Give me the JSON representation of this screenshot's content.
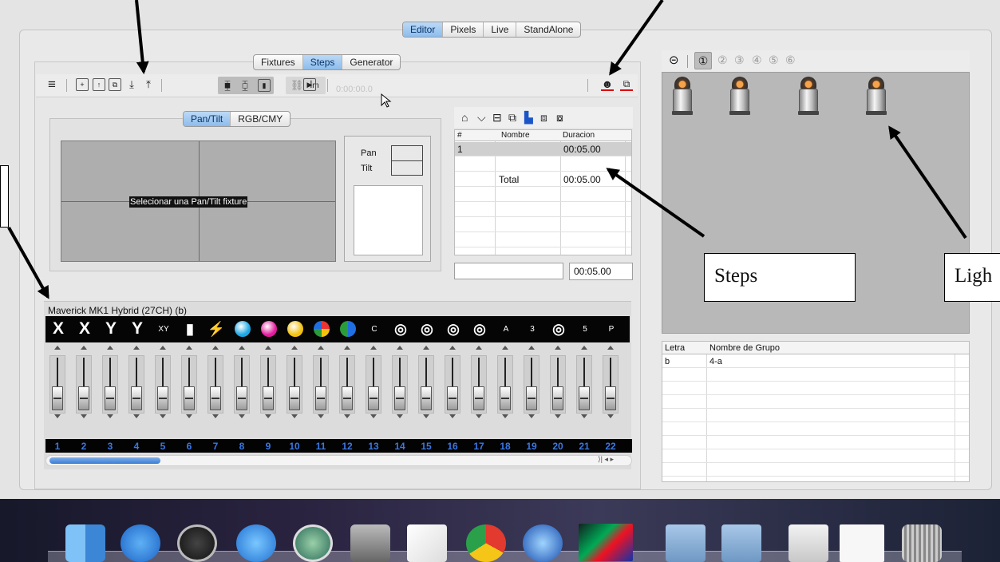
{
  "top_tabs": [
    "Editor",
    "Pixels",
    "Live",
    "StandAlone"
  ],
  "sub_tabs": [
    "Fixtures",
    "Steps",
    "Generator"
  ],
  "toolbar": {
    "time_readout": "0:00:00.0"
  },
  "pantilt": {
    "mode_tabs": [
      "Pan/Tilt",
      "RGB/CMY"
    ],
    "placeholder": "Selecionar una Pan/Tilt fixture",
    "pan_label": "Pan",
    "tilt_label": "Tilt"
  },
  "steps": {
    "columns": [
      "#",
      "Nombre",
      "Duracion"
    ],
    "rows": [
      {
        "num": "1",
        "name": "",
        "duration": "00:05.00"
      }
    ],
    "total_label": "Total",
    "total_value": "00:05.00",
    "duration_field": "00:05.00"
  },
  "channels": {
    "fixture_name": "Maverick MK1 Hybrid (27CH) (b)",
    "icon_labels": [
      "X",
      "X",
      "Y",
      "Y",
      "XY",
      "",
      "",
      "",
      "",
      "",
      "",
      "",
      "C",
      "",
      "",
      "",
      "",
      "A",
      "3",
      "",
      "5",
      "P"
    ],
    "numbers": [
      "1",
      "2",
      "3",
      "4",
      "5",
      "6",
      "7",
      "8",
      "9",
      "10",
      "11",
      "12",
      "13",
      "14",
      "15",
      "16",
      "17",
      "18",
      "19",
      "20",
      "21",
      "22"
    ]
  },
  "groups": {
    "buttons": [
      "⊝",
      "①",
      "②",
      "③",
      "④",
      "⑤",
      "⑥"
    ],
    "columns": [
      "Letra",
      "Nombre de Grupo"
    ],
    "rows": [
      {
        "letter": "b",
        "name": "4-a"
      }
    ]
  },
  "annotations": {
    "steps": "Steps",
    "lights": "Ligh"
  },
  "colors": {
    "accent": "#8cbcec",
    "channel_numbers": "#3a78e6"
  }
}
